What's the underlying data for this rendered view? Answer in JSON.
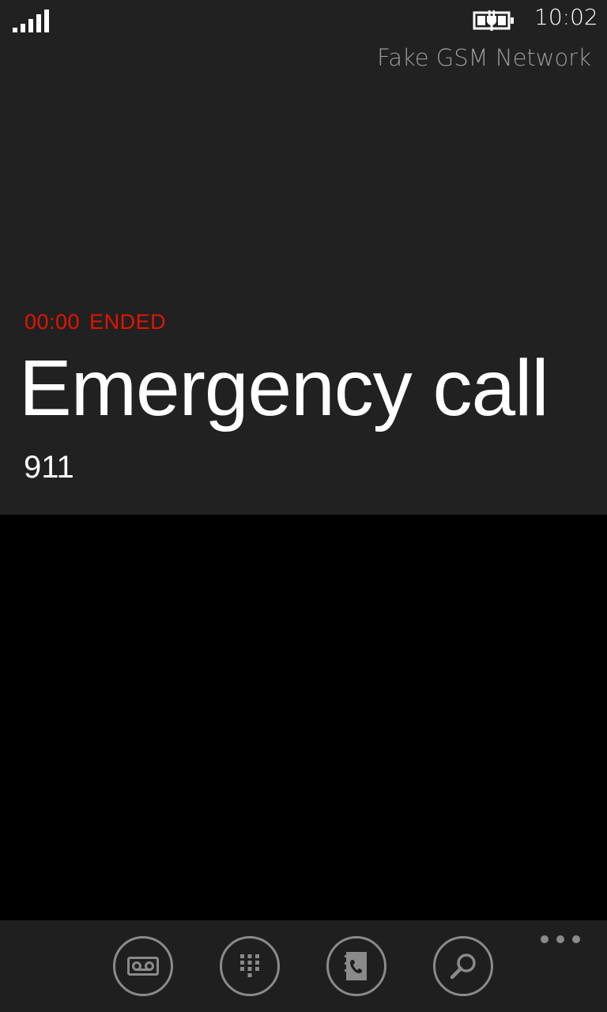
{
  "status_bar": {
    "time": "10:02",
    "network": "Fake GSM Network",
    "signal_icon": "signal-strength-icon",
    "battery_icon": "battery-charging-icon"
  },
  "call": {
    "duration": "00:00",
    "state": "ENDED",
    "title": "Emergency call",
    "number": "911"
  },
  "app_bar": {
    "buttons": [
      {
        "name": "voicemail",
        "icon": "voicemail-icon"
      },
      {
        "name": "keypad",
        "icon": "keypad-icon"
      },
      {
        "name": "contacts",
        "icon": "phonebook-icon"
      },
      {
        "name": "search",
        "icon": "search-icon"
      }
    ],
    "more_icon": "ellipsis-icon"
  },
  "colors": {
    "accent_red": "#e51400",
    "panel_bg": "#212121",
    "app_bar_bg": "#1f1f1f",
    "icon_gray": "#8a8a8a",
    "network_text": "#9b9b9b"
  }
}
